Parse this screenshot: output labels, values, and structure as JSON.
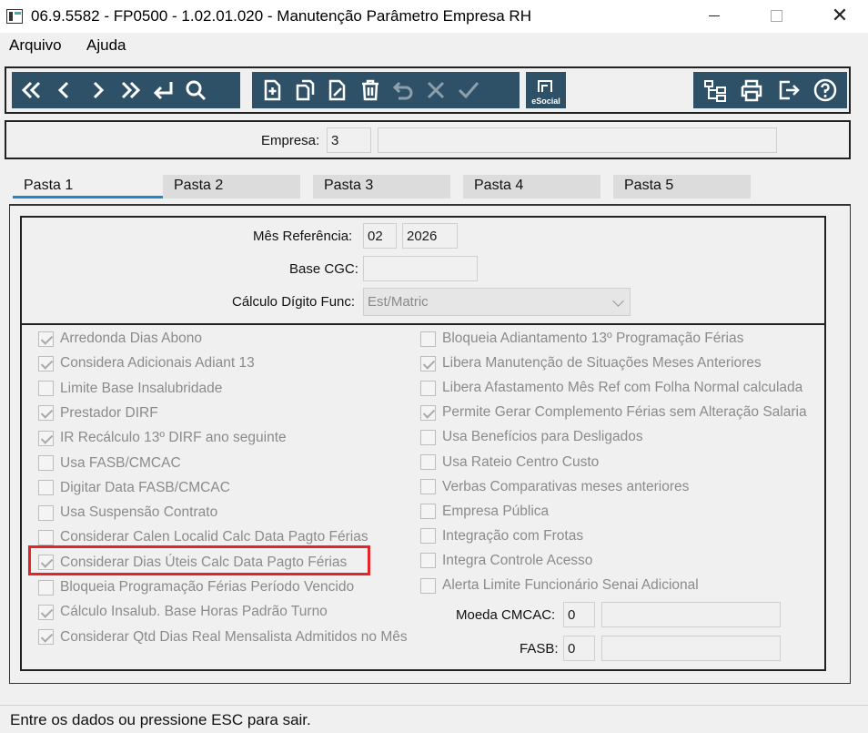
{
  "window": {
    "title": "06.9.5582 - FP0500 - 1.02.01.020 - Manutenção Parâmetro Empresa RH",
    "minimize_icon": "minimize-icon",
    "maximize_icon": "maximize-icon",
    "close_glyph": "✕"
  },
  "menu": {
    "items": [
      "Arquivo",
      "Ajuda"
    ]
  },
  "toolbar": {
    "nav_icons": [
      "first-record-icon",
      "previous-record-icon",
      "next-record-icon",
      "last-record-icon",
      "return-icon",
      "search-icon"
    ],
    "edit_icons": [
      "new-record-icon",
      "copy-record-icon",
      "edit-record-icon",
      "delete-record-icon",
      "undo-icon",
      "cancel-icon",
      "confirm-icon"
    ],
    "esocial_label": "eSocial",
    "right_icons": [
      "tree-icon",
      "print-icon",
      "exit-icon",
      "help-icon"
    ],
    "colors": {
      "background": "#2e5168",
      "icon": "#ffffff"
    }
  },
  "empresa": {
    "label": "Empresa:",
    "code": "3",
    "name": ""
  },
  "tabs": [
    "Pasta 1",
    "Pasta 2",
    "Pasta 3",
    "Pasta 4",
    "Pasta 5"
  ],
  "active_tab": "Pasta 1",
  "form": {
    "mes_referencia": {
      "label": "Mês Referência:",
      "month": "02",
      "year": "2026"
    },
    "base_cgc": {
      "label": "Base CGC:",
      "value": ""
    },
    "calculo_digito": {
      "label": "Cálculo Dígito Func:",
      "value": "Est/Matric"
    }
  },
  "checkboxes_left": [
    {
      "label": "Arredonda Dias Abono",
      "checked": true
    },
    {
      "label": "Considera Adicionais Adiant 13",
      "checked": true
    },
    {
      "label": "Limite Base Insalubridade",
      "checked": false
    },
    {
      "label": "Prestador DIRF",
      "checked": true
    },
    {
      "label": "IR Recálculo 13º DIRF ano seguinte",
      "checked": true
    },
    {
      "label": "Usa FASB/CMCAC",
      "checked": false
    },
    {
      "label": "Digitar Data FASB/CMCAC",
      "checked": false
    },
    {
      "label": "Usa Suspensão Contrato",
      "checked": false
    },
    {
      "label": "Considerar Calen Localid Calc Data Pagto Férias",
      "checked": false
    },
    {
      "label": "Considerar Dias Úteis Calc Data Pagto Férias",
      "checked": true
    },
    {
      "label": "Bloqueia Programação Férias Período Vencido",
      "checked": false
    },
    {
      "label": "Cálculo Insalub. Base Horas Padrão Turno",
      "checked": true
    },
    {
      "label": "Considerar Qtd Dias Real Mensalista Admitidos no Mês",
      "checked": true
    }
  ],
  "checkboxes_right": [
    {
      "label": "Bloqueia Adiantamento 13º Programação Férias",
      "checked": false
    },
    {
      "label": "Libera Manutenção de Situações Meses Anteriores",
      "checked": true
    },
    {
      "label": "Libera Afastamento Mês Ref com Folha Normal calculada",
      "checked": false
    },
    {
      "label": "Permite Gerar Complemento Férias sem Alteração Salaria",
      "checked": true
    },
    {
      "label": "Usa Benefícios para Desligados",
      "checked": false
    },
    {
      "label": "Usa Rateio Centro Custo",
      "checked": false
    },
    {
      "label": "Verbas Comparativas meses anteriores",
      "checked": false
    },
    {
      "label": "Empresa Pública",
      "checked": false
    },
    {
      "label": "Integração com Frotas",
      "checked": false
    },
    {
      "label": "Integra Controle Acesso",
      "checked": false
    },
    {
      "label": "Alerta Limite Funcionário Senai Adicional",
      "checked": false
    }
  ],
  "moeda_cmcac": {
    "label": "Moeda CMCAC:",
    "code": "0",
    "desc": ""
  },
  "fasb": {
    "label": "FASB:",
    "code": "0",
    "desc": ""
  },
  "highlight": {
    "target": "Considerar Dias Úteis Calc Data Pagto Férias",
    "color": "#e3242b"
  },
  "status": {
    "text": "Entre os dados ou pressione ESC para sair."
  }
}
